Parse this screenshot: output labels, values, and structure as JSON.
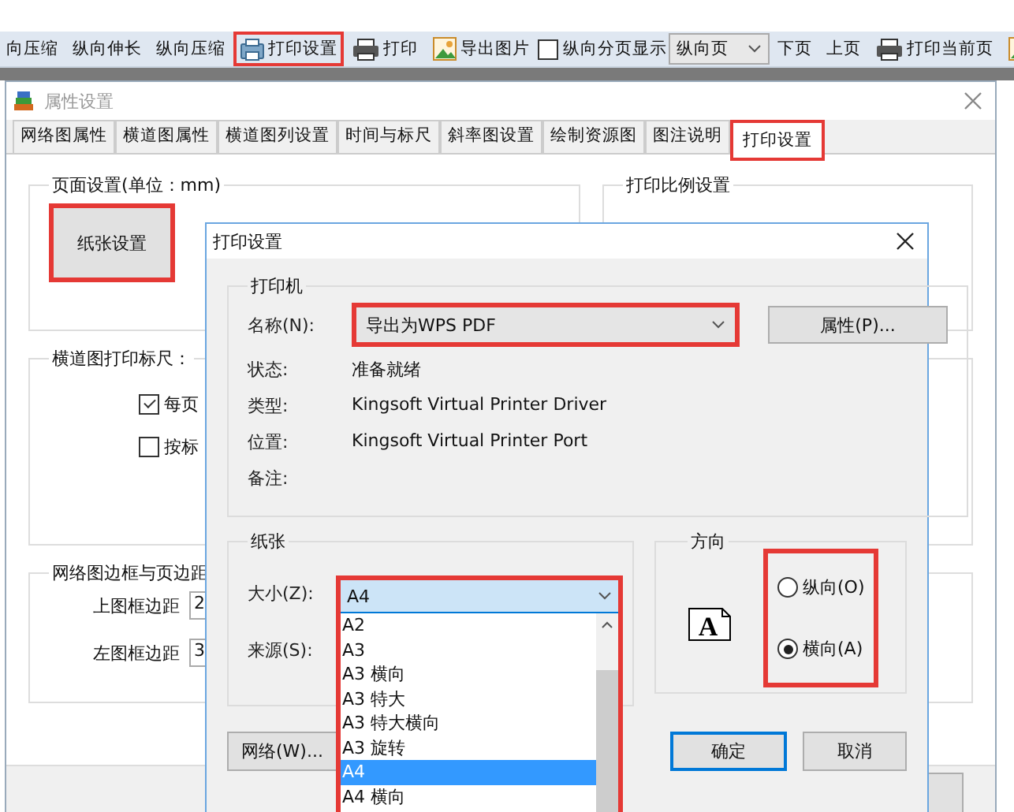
{
  "toolbar": {
    "items": [
      {
        "kind": "text",
        "label": "向压缩",
        "highlighted": false
      },
      {
        "kind": "text",
        "label": "纵向伸长",
        "highlighted": false
      },
      {
        "kind": "text",
        "label": "纵向压缩",
        "highlighted": false
      },
      {
        "kind": "settings",
        "label": "打印设置",
        "highlighted": true
      },
      {
        "kind": "print",
        "label": "打印",
        "highlighted": false
      },
      {
        "kind": "image",
        "label": "导出图片",
        "highlighted": false
      },
      {
        "kind": "checkbox",
        "label": "纵向分页显示",
        "checked": false
      },
      {
        "kind": "select",
        "value": "纵向页"
      },
      {
        "kind": "text",
        "label": "下页",
        "highlighted": false
      },
      {
        "kind": "text",
        "label": "上页",
        "highlighted": false
      },
      {
        "kind": "print",
        "label": "打印当前页",
        "highlighted": false
      },
      {
        "kind": "image",
        "highlighted": false
      }
    ]
  },
  "properties_dialog": {
    "title": "属性设置",
    "tabs": [
      {
        "label": "网络图属性",
        "selected": false,
        "highlighted": false
      },
      {
        "label": "横道图属性",
        "selected": false,
        "highlighted": false
      },
      {
        "label": "横道图列设置",
        "selected": false,
        "highlighted": false
      },
      {
        "label": "时间与标尺",
        "selected": false,
        "highlighted": false
      },
      {
        "label": "斜率图设置",
        "selected": false,
        "highlighted": false
      },
      {
        "label": "绘制资源图",
        "selected": false,
        "highlighted": false
      },
      {
        "label": "图注说明",
        "selected": false,
        "highlighted": false
      },
      {
        "label": "打印设置",
        "selected": true,
        "highlighted": true
      }
    ],
    "page_setup": {
      "title": "页面设置(单位：mm)",
      "button": {
        "label": "纸张设置",
        "highlighted": true
      }
    },
    "scale_setup": {
      "title": "打印比例设置"
    },
    "ruler": {
      "title": "横道图打印标尺：",
      "options": [
        {
          "label": "每页",
          "checked": true
        },
        {
          "label": "按标",
          "checked": false
        }
      ]
    },
    "margins": {
      "title": "网络图边框与页边距",
      "fields": [
        {
          "label": "上图框边距",
          "value": "2"
        },
        {
          "label": "左图框边距",
          "value": "3"
        }
      ]
    }
  },
  "print_dialog": {
    "title": "打印设置",
    "printer": {
      "title": "打印机",
      "name_label": "名称(N):",
      "name_value": "导出为WPS PDF",
      "name_highlighted": true,
      "properties_button": "属性(P)...",
      "info": [
        {
          "label": "状态:",
          "value": "准备就绪"
        },
        {
          "label": "类型:",
          "value": "Kingsoft Virtual Printer Driver"
        },
        {
          "label": "位置:",
          "value": "Kingsoft Virtual Printer Port"
        },
        {
          "label": "备注:"
        }
      ]
    },
    "paper": {
      "title": "纸张",
      "size_label": "大小(Z):",
      "size_value": "A4",
      "source_label": "来源(S):",
      "highlighted": true,
      "size_options": [
        {
          "label": "A2",
          "selected": false
        },
        {
          "label": "A3",
          "selected": false
        },
        {
          "label": "A3 横向",
          "selected": false
        },
        {
          "label": "A3 特大",
          "selected": false
        },
        {
          "label": "A3 特大横向",
          "selected": false
        },
        {
          "label": "A3 旋转",
          "selected": false
        },
        {
          "label": "A4",
          "selected": true
        },
        {
          "label": "A4 横向",
          "selected": false
        }
      ]
    },
    "orientation": {
      "title": "方向",
      "page_glyph": "A",
      "highlighted": true,
      "options": [
        {
          "label": "纵向(O)",
          "selected": false
        },
        {
          "label": "横向(A)",
          "selected": true
        }
      ]
    },
    "buttons": [
      {
        "kind": "left",
        "label": "网络(W)...",
        "default": false
      },
      {
        "kind": "right",
        "label": "确定",
        "default": true
      },
      {
        "kind": "right",
        "label": "取消",
        "default": false
      }
    ]
  }
}
